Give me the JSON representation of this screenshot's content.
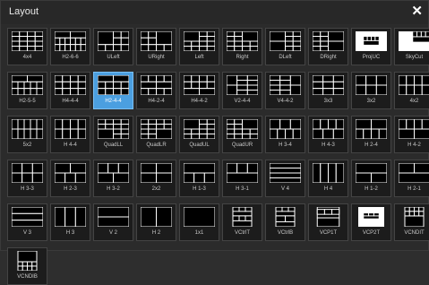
{
  "window": {
    "title": "Layout",
    "close_glyph": "✕"
  },
  "layouts": [
    {
      "label": "4x4",
      "pattern": "grid4x4"
    },
    {
      "label": "H2-6-6",
      "pattern": "h266"
    },
    {
      "label": "ULeft",
      "pattern": "uleft"
    },
    {
      "label": "URight",
      "pattern": "uright"
    },
    {
      "label": "Left",
      "pattern": "left"
    },
    {
      "label": "Right",
      "pattern": "right"
    },
    {
      "label": "DLeft",
      "pattern": "dleft"
    },
    {
      "label": "DRight",
      "pattern": "dright"
    },
    {
      "label": "ProjUC",
      "pattern": "projuc"
    },
    {
      "label": "SkyCut",
      "pattern": "skycut"
    },
    {
      "label": "H2-5-5",
      "pattern": "h255"
    },
    {
      "label": "H4-4-4",
      "pattern": "h444"
    },
    {
      "label": "H2-4-4",
      "pattern": "h244",
      "selected": true
    },
    {
      "label": "H4-2-4",
      "pattern": "h424"
    },
    {
      "label": "H4-4-2",
      "pattern": "h442"
    },
    {
      "label": "V2-4-4",
      "pattern": "v244"
    },
    {
      "label": "V4-4-2",
      "pattern": "v442"
    },
    {
      "label": "3x3",
      "pattern": "grid3x3"
    },
    {
      "label": "3x2",
      "pattern": "grid3x2"
    },
    {
      "label": "4x2",
      "pattern": "grid4x2"
    },
    {
      "label": "5x2",
      "pattern": "grid5x2"
    },
    {
      "label": "H 4-4",
      "pattern": "h44"
    },
    {
      "label": "QuadLL",
      "pattern": "quadll"
    },
    {
      "label": "QuadLR",
      "pattern": "quadlr"
    },
    {
      "label": "QuadUL",
      "pattern": "quadul"
    },
    {
      "label": "QuadUR",
      "pattern": "quadur"
    },
    {
      "label": "H 3-4",
      "pattern": "h34"
    },
    {
      "label": "H 4-3",
      "pattern": "h43"
    },
    {
      "label": "H 2-4",
      "pattern": "h24"
    },
    {
      "label": "H 4-2",
      "pattern": "h42"
    },
    {
      "label": "H 3-3",
      "pattern": "h33"
    },
    {
      "label": "H 2-3",
      "pattern": "h23"
    },
    {
      "label": "H 3-2",
      "pattern": "h32"
    },
    {
      "label": "2x2",
      "pattern": "grid2x2"
    },
    {
      "label": "H 1-3",
      "pattern": "h13"
    },
    {
      "label": "H 3-1",
      "pattern": "h31"
    },
    {
      "label": "V 4",
      "pattern": "v4"
    },
    {
      "label": "H 4",
      "pattern": "hh4"
    },
    {
      "label": "H 1-2",
      "pattern": "h12"
    },
    {
      "label": "H 2-1",
      "pattern": "h21"
    },
    {
      "label": "V 3",
      "pattern": "v3"
    },
    {
      "label": "H 3",
      "pattern": "hh3"
    },
    {
      "label": "V 2",
      "pattern": "v2"
    },
    {
      "label": "H 2",
      "pattern": "hh2"
    },
    {
      "label": "1x1",
      "pattern": "one"
    },
    {
      "label": "VCtrlT",
      "pattern": "vctrlt"
    },
    {
      "label": "VCtrlB",
      "pattern": "vctrlb"
    },
    {
      "label": "VCP1T",
      "pattern": "vcp1t"
    },
    {
      "label": "VCP2T",
      "pattern": "vcp2t"
    },
    {
      "label": "VCNDIT",
      "pattern": "vcndit"
    },
    {
      "label": "VCNDIB",
      "pattern": "vcndib"
    }
  ]
}
